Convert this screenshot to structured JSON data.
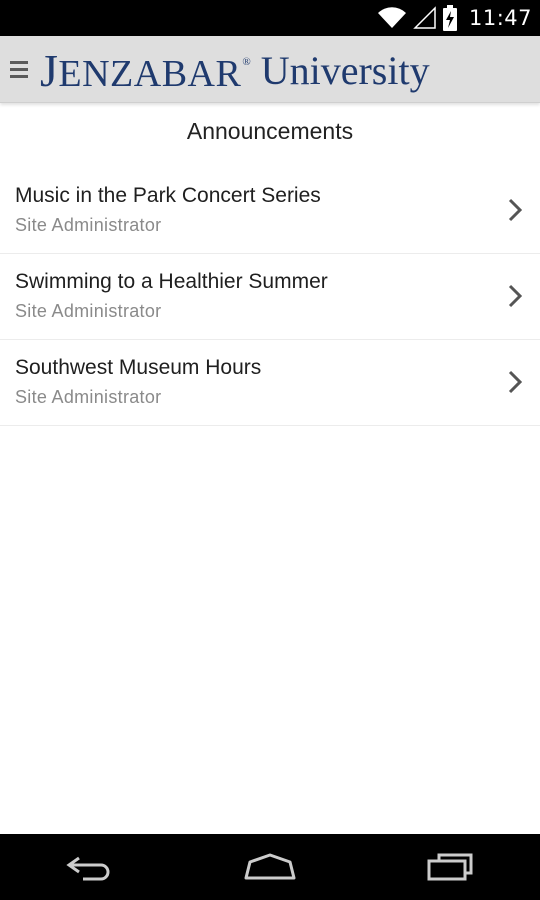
{
  "status_bar": {
    "time": "11:47",
    "icons": [
      "wifi-icon",
      "signal-icon",
      "battery-charging-icon"
    ]
  },
  "header": {
    "brand_name": "ENZABAR",
    "brand_initial": "J",
    "brand_registered": "®",
    "brand_suffix": "University",
    "brand_color": "#1f3a6e",
    "menu_icon": "hamburger-menu-icon"
  },
  "page": {
    "title": "Announcements"
  },
  "announcements": [
    {
      "title": "Music in the Park Concert Series",
      "author": "Site  Administrator"
    },
    {
      "title": "Swimming to a Healthier Summer",
      "author": "Site  Administrator"
    },
    {
      "title": "Southwest Museum Hours",
      "author": "Site  Administrator"
    }
  ],
  "nav_bar": {
    "icons": [
      "back-icon",
      "home-icon",
      "recent-apps-icon"
    ]
  }
}
